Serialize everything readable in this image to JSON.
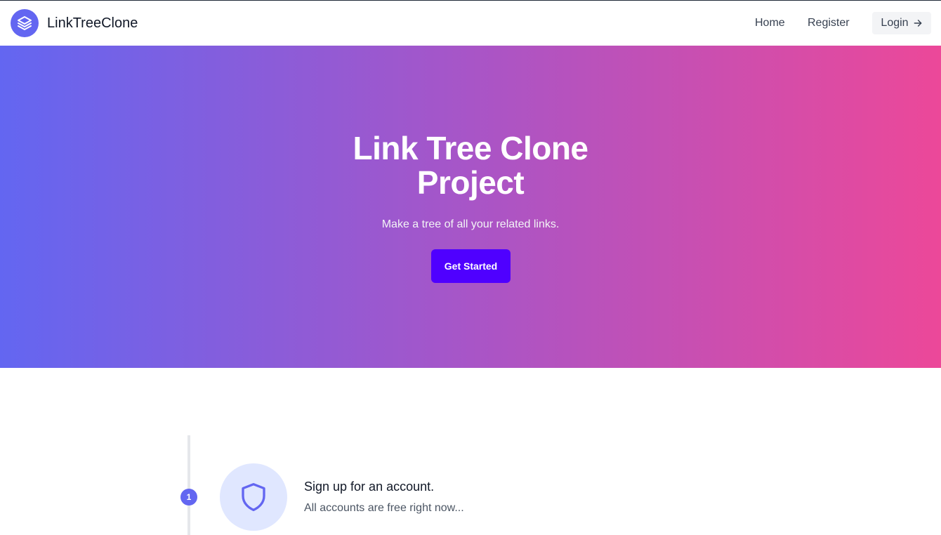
{
  "header": {
    "brand": "LinkTreeClone",
    "nav": {
      "home": "Home",
      "register": "Register",
      "login": "Login"
    }
  },
  "hero": {
    "title_line1": "Link Tree Clone",
    "title_line2": "Project",
    "subtitle": "Make a tree of all your related links.",
    "cta": "Get Started"
  },
  "steps": [
    {
      "number": "1",
      "icon": "shield-icon",
      "title": "Sign up for an account.",
      "description": "All accounts are free right now..."
    }
  ],
  "colors": {
    "accent": "#6366f1",
    "cta": "#4f00ff",
    "gradient_start": "#6366f1",
    "gradient_end": "#ec4899"
  }
}
